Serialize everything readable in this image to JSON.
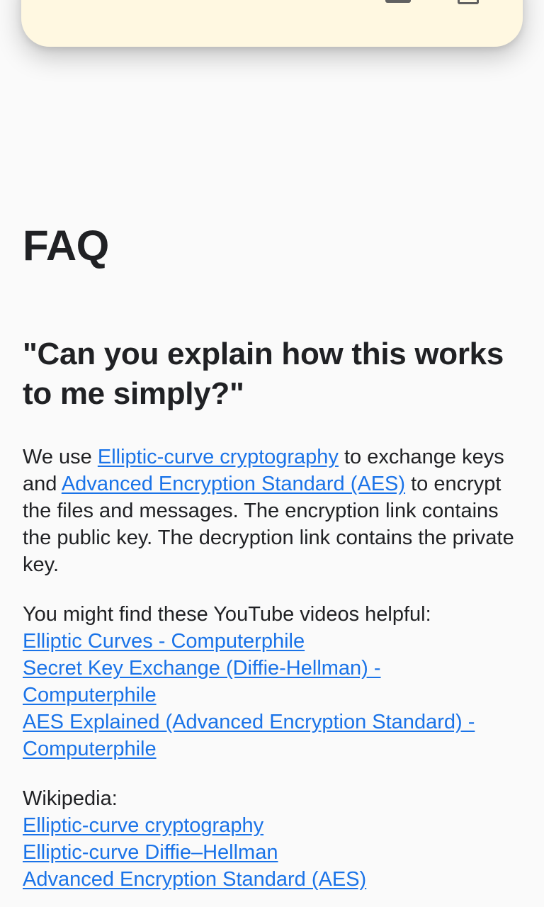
{
  "faq": {
    "title": "FAQ",
    "question": "\"Can you explain how this works to me simply?\"",
    "answer": {
      "part1": "We use ",
      "link_ecc": "Elliptic-curve cryptography",
      "part2": " to exchange keys and ",
      "link_aes": "Advanced Encryption Standard (AES)",
      "part3": " to encrypt the files and messages. The encryption link contains the public key. The decryption link contains the private key."
    },
    "videos": {
      "intro": "You might find these YouTube videos helpful:",
      "links": [
        "Elliptic Curves - Computerphile",
        "Secret Key Exchange (Diffie-Hellman) - Computerphile",
        "AES Explained (Advanced Encryption Standard) - Computerphile"
      ]
    },
    "wikipedia": {
      "intro": "Wikipedia:",
      "links": [
        "Elliptic-curve cryptography",
        "Elliptic-curve Diffie–Hellman",
        "Advanced Encryption Standard (AES)"
      ]
    }
  }
}
